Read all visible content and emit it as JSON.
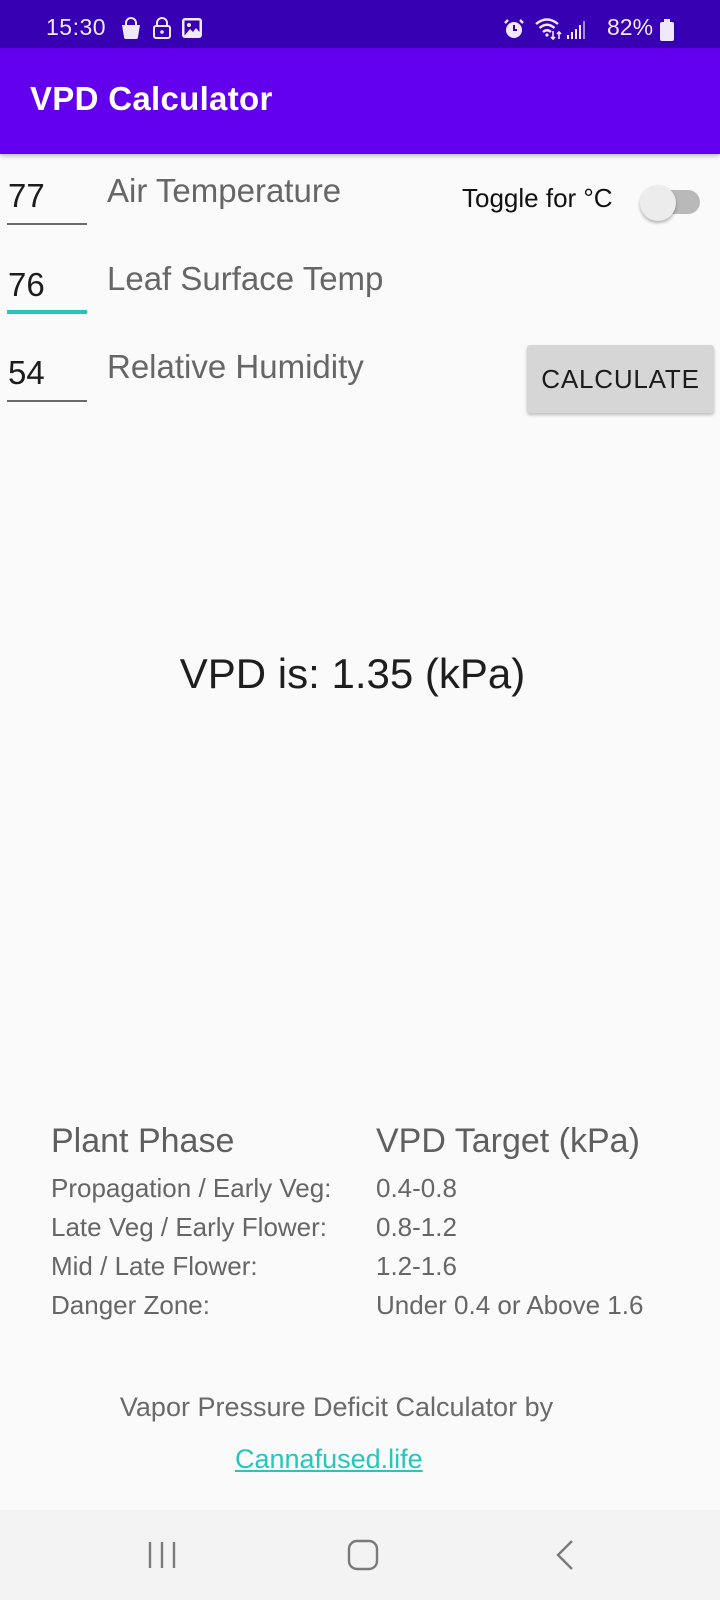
{
  "status_bar": {
    "time": "15:30",
    "left_icons": [
      "shopping-bag-icon",
      "lock-icon",
      "image-icon"
    ],
    "right_icons": [
      "alarm-icon",
      "wifi-icon",
      "signal-icon",
      "battery-icon"
    ],
    "battery_percent": "82%"
  },
  "app_bar": {
    "title": "VPD Calculator",
    "color": "#6200ee",
    "status_color": "#3700b3"
  },
  "form": {
    "air_temperature": {
      "value": "77",
      "label": "Air Temperature"
    },
    "leaf_surface_temp": {
      "value": "76",
      "label": "Leaf Surface Temp",
      "focused": true
    },
    "relative_humidity": {
      "value": "54",
      "label": "Relative Humidity"
    },
    "unit_toggle": {
      "label": "Toggle for °C",
      "checked": false
    },
    "calculate_label": "CALCULATE",
    "accent_color": "#26c6bb"
  },
  "result": {
    "text": "VPD is: 1.35 (kPa)"
  },
  "reference_table": {
    "headers": [
      "Plant Phase",
      "VPD Target (kPa)"
    ],
    "rows": [
      {
        "phase": "Propagation / Early Veg:",
        "target": "0.4-0.8"
      },
      {
        "phase": "Late Veg / Early Flower:",
        "target": "0.8-1.2"
      },
      {
        "phase": "Mid / Late Flower:",
        "target": "1.2-1.6"
      },
      {
        "phase": "Danger Zone:",
        "target": "Under 0.4 or Above 1.6"
      }
    ]
  },
  "footer": {
    "credit": "Vapor Pressure Deficit Calculator by",
    "link_text": "Cannafused.life"
  },
  "nav_bar": {
    "buttons": [
      "recent-apps-icon",
      "home-icon",
      "back-icon"
    ]
  }
}
